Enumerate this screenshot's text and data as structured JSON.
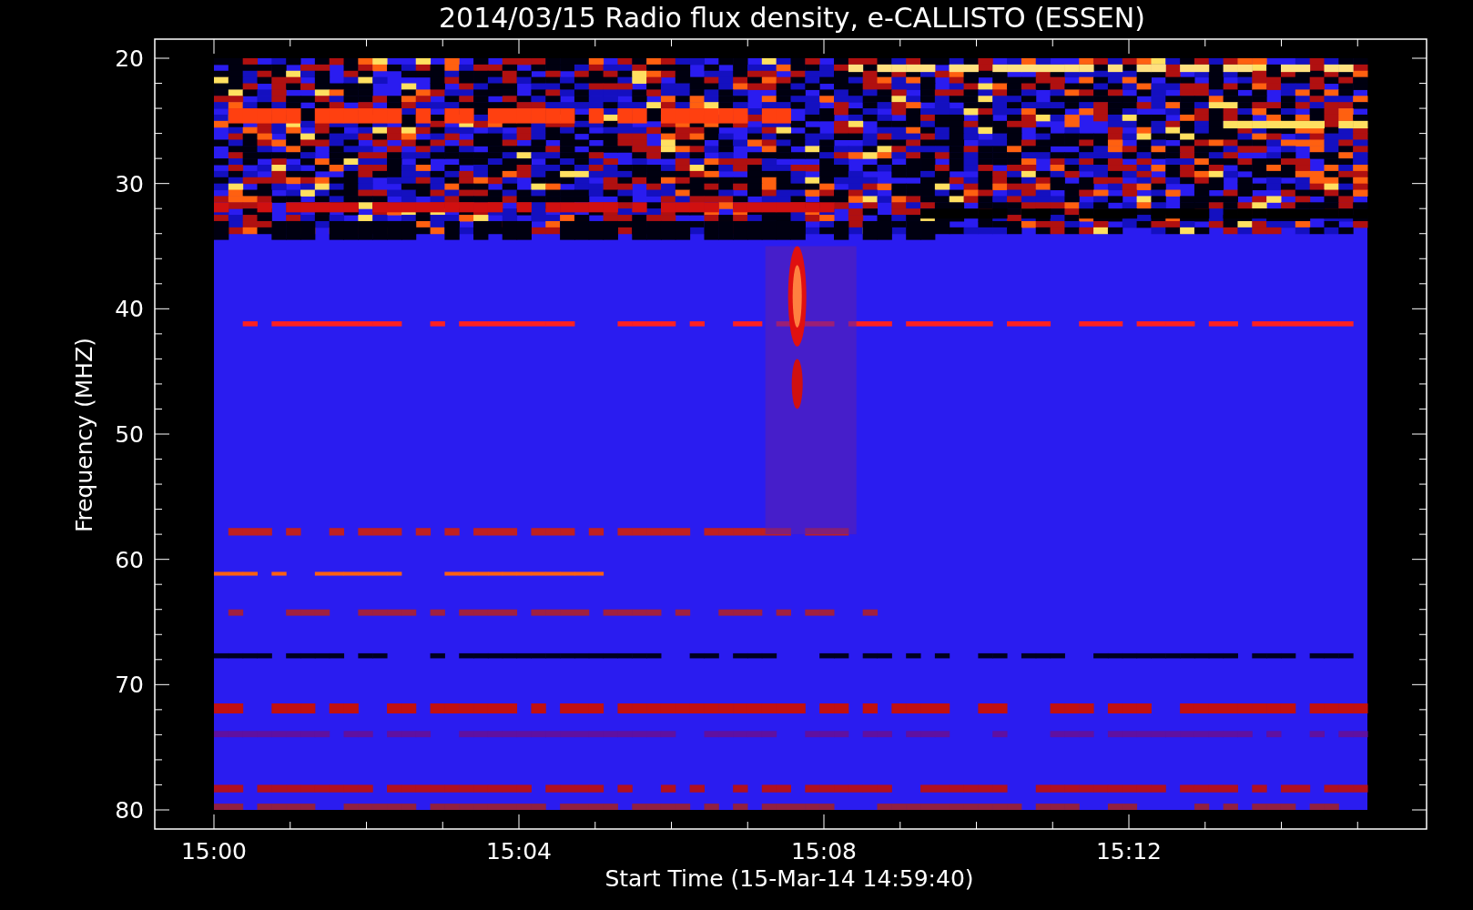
{
  "chart": {
    "title": "2014/03/15  Radio flux density, e-CALLISTO (ESSEN)",
    "ylabel": "Frequency (MHZ)",
    "xlabel": "Start Time (15-Mar-14 14:59:40)",
    "yticks": [
      "20",
      "30",
      "40",
      "50",
      "60",
      "70",
      "80"
    ],
    "xticks": [
      "15:00",
      "15:04",
      "15:08",
      "15:12"
    ]
  }
}
